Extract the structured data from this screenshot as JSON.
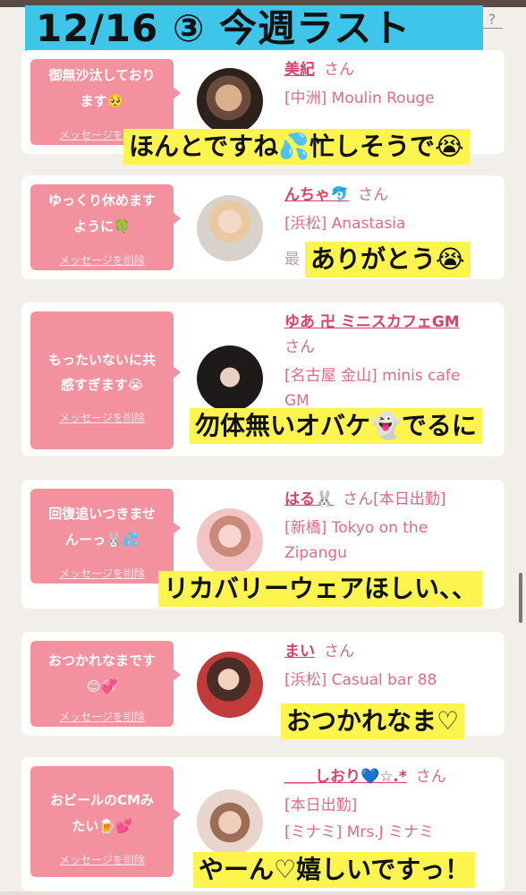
{
  "header": {
    "title": "12/16 ③ 今週ラスト",
    "help_label": "?"
  },
  "delete_label": "メッセージを削除",
  "cards": [
    {
      "message_lines": [
        "御無沙汰しており",
        "ます🥺"
      ],
      "cast_name": "美紀",
      "honorific": "さん",
      "shop_lines": [
        "[中洲] Moulin Rouge"
      ],
      "caption": "ほんとですね💦忙しそうで😭",
      "avatar": "avatar-filter-face"
    },
    {
      "message_lines": [
        "ゆっくり休めます",
        "ように🍀"
      ],
      "cast_name": "んちゃ🐬",
      "honorific": "さん",
      "shop_lines": [
        "[浜松] Anastasia",
        "最"
      ],
      "caption": "ありがとう😭",
      "avatar": "avatar-blonde"
    },
    {
      "message_lines": [
        "もったいないに共",
        "感すぎます😭"
      ],
      "cast_name": "ゆあ 卍 ミニスカフェGM",
      "honorific": "さん",
      "shop_lines": [
        "[名古屋 金山] minis cafe",
        "GM"
      ],
      "caption": "勿体無いオバケ👻でるに",
      "avatar": "avatar-dark-hair"
    },
    {
      "message_lines": [
        "回復追いつきませ",
        "んーっ🐰💦"
      ],
      "cast_name": "はる🐰",
      "honorific": "さん[本日出勤]",
      "shop_lines": [
        "[新橋] Tokyo on the",
        "Zipangu"
      ],
      "caption": "リカバリーウェアほしい、、",
      "avatar": "avatar-bunny-ears"
    },
    {
      "message_lines": [
        "おつかれなまです",
        "😊💞"
      ],
      "cast_name": "まい",
      "honorific": "さん",
      "shop_lines": [
        "[浜松] Casual bar 88"
      ],
      "caption": "おつかれなま♡",
      "avatar": "avatar-red-dress"
    },
    {
      "message_lines": [
        "おビールのCMみ",
        "たい🍺💕"
      ],
      "cast_name": "＿＿しおり💙☆.*",
      "honorific": "さん",
      "shop_lines": [
        "[本日出勤]",
        "[ミナミ] Mrs.J ミナミ"
      ],
      "caption": "やーん♡嬉しいですっ！",
      "avatar": "avatar-heart-face"
    }
  ]
}
